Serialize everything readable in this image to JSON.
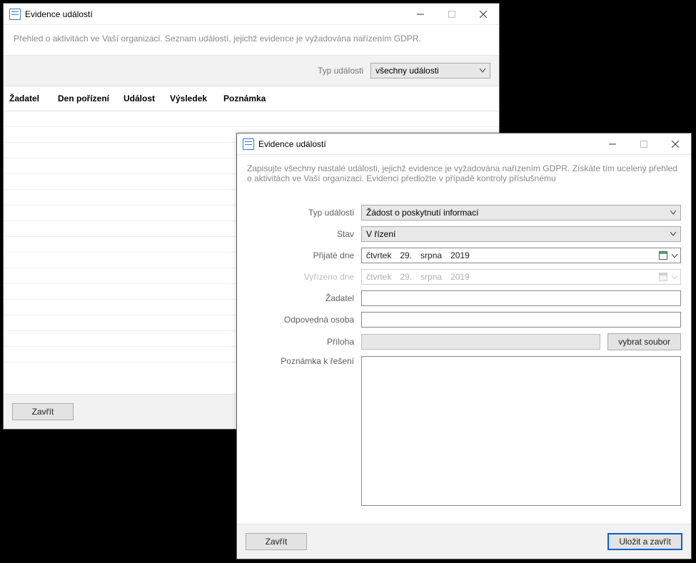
{
  "window1": {
    "title": "Evidence událostí",
    "description": "Přehled o aktivitách ve Vaší organizaci. Seznam událostí, jejichž evidence je vyžadována nařízením GDPR.",
    "filter_label": "Typ události",
    "filter_value": "všechny události",
    "columns": {
      "c0": "Žadatel",
      "c1": "Den pořízení",
      "c2": "Událost",
      "c3": "Výsledek",
      "c4": "Poznámka"
    },
    "close_btn": "Zavřít"
  },
  "window2": {
    "title": "Evidence událostí",
    "description": "Zapisujte všechny nastalé události, jejichž evidence je vyžadována nařízením GDPR. Získáte tím ucelený přehled o aktivitách ve Vaší organizaci. Evidenci předložte v případě kontroly příslušnému",
    "fields": {
      "type_label": "Typ události",
      "type_value": "Žádost o poskytnutí informací",
      "status_label": "Stav",
      "status_value": "V řízení",
      "received_label": "Přijaté dne",
      "received_date": {
        "dow": "čtvrtek",
        "day": "29.",
        "month": "srpna",
        "year": "2019"
      },
      "processed_label": "Vyřízeno dne",
      "processed_date": {
        "dow": "čtvrtek",
        "day": "29.",
        "month": "srpna",
        "year": "2019"
      },
      "requester_label": "Žadatel",
      "responsible_label": "Odpovedná osoba",
      "attachment_label": "Příloha",
      "attachment_btn": "vybrat soubor",
      "note_label": "Poznámka k řešení"
    },
    "close_btn": "Zavřít",
    "save_btn": "Uložit a zavřít"
  }
}
